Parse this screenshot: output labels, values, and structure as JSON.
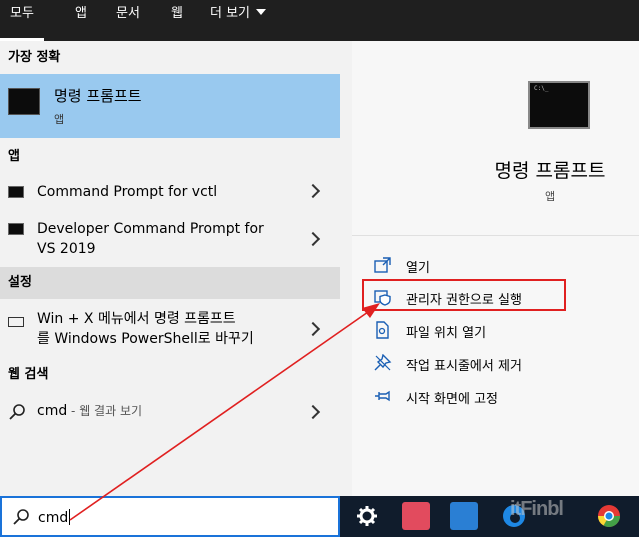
{
  "tabs": [
    "모두",
    "앱",
    "문서",
    "웹",
    "더 보기"
  ],
  "left": {
    "best_header": "가장 정확",
    "best": {
      "title": "명령 프롬프트",
      "sub": "앱"
    },
    "apps_header": "앱",
    "apps": [
      {
        "label": "Command Prompt for vctl"
      },
      {
        "label_line1": "Developer Command Prompt for",
        "label_line2": "VS 2019"
      }
    ],
    "settings_header": "설정",
    "settings": {
      "line1": "Win + X 메뉴에서 명령 프롬프트",
      "line2": "를 Windows PowerShell로 바꾸기"
    },
    "web_header": "웹 검색",
    "web": {
      "query": "cmd",
      "suffix": " - 웹 결과 보기"
    }
  },
  "right": {
    "title": "명령 프롬프트",
    "sub": "앱",
    "actions": [
      {
        "label": "열기",
        "icon": "open-icon"
      },
      {
        "label": "관리자 권한으로 실행",
        "icon": "shield-icon"
      },
      {
        "label": "파일 위치 열기",
        "icon": "file-location-icon"
      },
      {
        "label": "작업 표시줄에서 제거",
        "icon": "unpin-taskbar-icon"
      },
      {
        "label": "시작 화면에 고정",
        "icon": "pin-start-icon"
      }
    ]
  },
  "search": {
    "value": "cmd"
  },
  "watermark": "itFinbl",
  "colors": {
    "highlight": "#99c9ef",
    "accent": "#1a73d9",
    "annotation": "#e02020"
  }
}
